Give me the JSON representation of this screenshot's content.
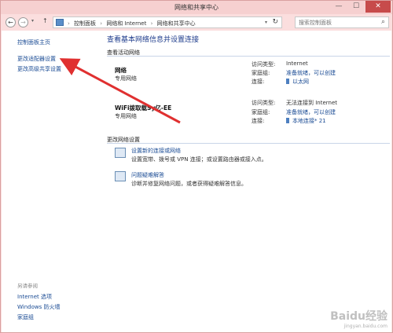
{
  "window": {
    "title": "网络和共享中心",
    "minimize_icon": "—",
    "maximize_icon": "☐",
    "close_icon": "✕"
  },
  "toolbar": {
    "back_icon": "←",
    "forward_icon": "→",
    "up_icon": "↑",
    "breadcrumbs": [
      "控制面板",
      "网络和 Internet",
      "网络和共享中心"
    ],
    "breadcrumb_sep": "›",
    "search_placeholder": "搜索控制面板",
    "search_icon": "⌕",
    "refresh_icon": "↻"
  },
  "sidebar": {
    "items": [
      {
        "label": "控制面板主页"
      },
      {
        "label": "更改适配器设置"
      },
      {
        "label": "更改高级共享设置"
      }
    ],
    "see_also_title": "另请参阅",
    "see_also": [
      {
        "label": "Internet 选项"
      },
      {
        "label": "Windows 防火墙"
      },
      {
        "label": "家庭组"
      }
    ]
  },
  "main": {
    "heading": "查看基本网络信息并设置连接",
    "active_networks_label": "查看活动网络",
    "networks": [
      {
        "name": "网络",
        "type": "专用网络",
        "access_type_key": "访问类型:",
        "access_type_value": "Internet",
        "homegroup_key": "家庭组:",
        "homegroup_value": "准备就绪，可以创建",
        "connection_key": "连接:",
        "connection_value": "以太网"
      },
      {
        "name": "WiFi拨取载Sy亿-EE",
        "type": "专用网络",
        "access_type_key": "访问类型:",
        "access_type_value": "无法连接到 Internet",
        "homegroup_key": "家庭组:",
        "homegroup_value": "准备就绪，可以创建",
        "connection_key": "连接:",
        "connection_value": "本地连接* 21"
      }
    ],
    "change_settings_label": "更改网络设置",
    "settings": [
      {
        "link": "设置新的连接或网络",
        "desc": "设置宽带、拨号或 VPN 连接；或设置路由器或接入点。",
        "icon": "network-setup-icon"
      },
      {
        "link": "问题疑难解答",
        "desc": "诊断并修复网络问题，或者获得疑难解答信息。",
        "icon": "troubleshoot-icon"
      }
    ]
  },
  "annotation": {
    "arrow_color": "#e03030"
  },
  "watermark": {
    "logo": "Baidu经验",
    "url": "jingyan.baidu.com"
  }
}
